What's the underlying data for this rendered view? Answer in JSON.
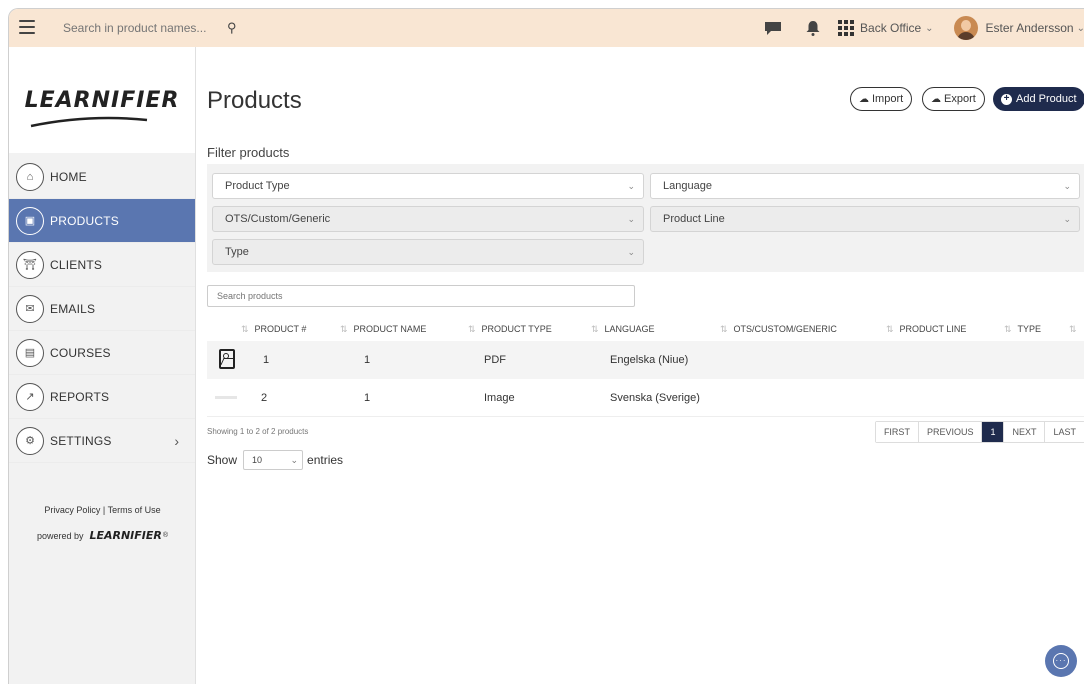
{
  "topbar": {
    "search_placeholder": "Search in product names...",
    "workspace_label": "Back Office",
    "user_name": "Ester Andersson"
  },
  "sidebar": {
    "logo_text": "LEARNIFIER",
    "items": [
      {
        "label": "HOME",
        "icon": "home-icon"
      },
      {
        "label": "PRODUCTS",
        "icon": "products-icon",
        "active": true
      },
      {
        "label": "CLIENTS",
        "icon": "clients-icon"
      },
      {
        "label": "EMAILS",
        "icon": "email-icon"
      },
      {
        "label": "COURSES",
        "icon": "courses-icon"
      },
      {
        "label": "REPORTS",
        "icon": "reports-icon"
      },
      {
        "label": "SETTINGS",
        "icon": "settings-icon"
      }
    ],
    "footer_links": "Privacy Policy | Terms of Use",
    "powered_by": "powered by",
    "powered_logo": "LEARNIFIER"
  },
  "main": {
    "title": "Products",
    "import_label": "Import",
    "export_label": "Export",
    "add_label": "Add Product",
    "filter_heading": "Filter products",
    "filters": {
      "product_type": "Product Type",
      "language": "Language",
      "ots": "OTS/Custom/Generic",
      "product_line": "Product Line",
      "type": "Type"
    },
    "search_placeholder": "Search products",
    "table": {
      "headers": [
        "PRODUCT #",
        "PRODUCT NAME",
        "PRODUCT TYPE",
        "LANGUAGE",
        "OTS/CUSTOM/GENERIC",
        "PRODUCT LINE",
        "TYPE"
      ],
      "rows": [
        {
          "number": "1",
          "name": "1",
          "type": "PDF",
          "language": "Engelska (Niue)"
        },
        {
          "number": "2",
          "name": "1",
          "type": "Image",
          "language": "Svenska (Sverige)"
        }
      ]
    },
    "showing_text": "Showing 1 to 2 of 2 products",
    "show_label": "Show",
    "entries_value": "10",
    "entries_label": "entries",
    "pager": {
      "first": "FIRST",
      "previous": "PREVIOUS",
      "current": "1",
      "next": "NEXT",
      "last": "LAST"
    }
  },
  "colors": {
    "topbar_bg": "#f9e6d3",
    "sidebar_active": "#5a76b0",
    "primary_dark": "#1f2b4d"
  }
}
